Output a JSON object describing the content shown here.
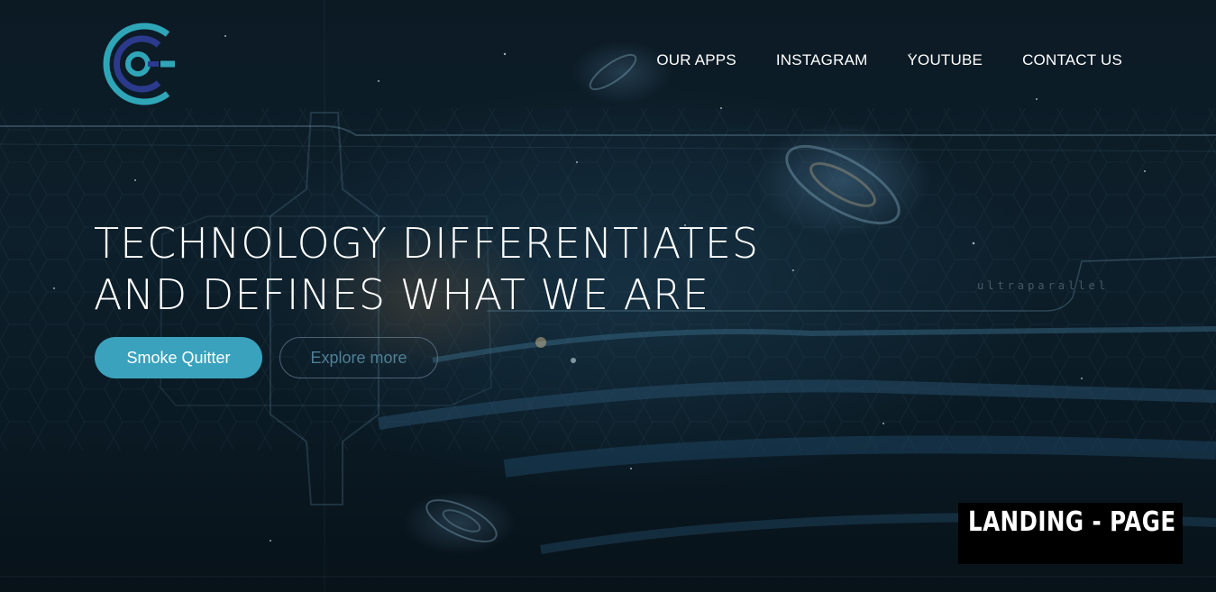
{
  "brand": {
    "logo_icon": "concentric-c-logo-icon",
    "colors": {
      "teal": "#3aa2bd",
      "indigo": "#2b3a8c"
    }
  },
  "nav": {
    "items": [
      {
        "label": "OUR APPS"
      },
      {
        "label": "INSTAGRAM"
      },
      {
        "label": "YOUTUBE"
      },
      {
        "label": "CONTACT US"
      }
    ]
  },
  "hero": {
    "headline_line1": "TECHNOLOGY DIFFERENTIATES",
    "headline_line2": "AND DEFINES WHAT WE ARE",
    "primary_button": "Smoke Quitter",
    "secondary_button": "Explore more",
    "background_text": "ultraparallel"
  },
  "badge": {
    "label": "LANDING - PAGE"
  }
}
